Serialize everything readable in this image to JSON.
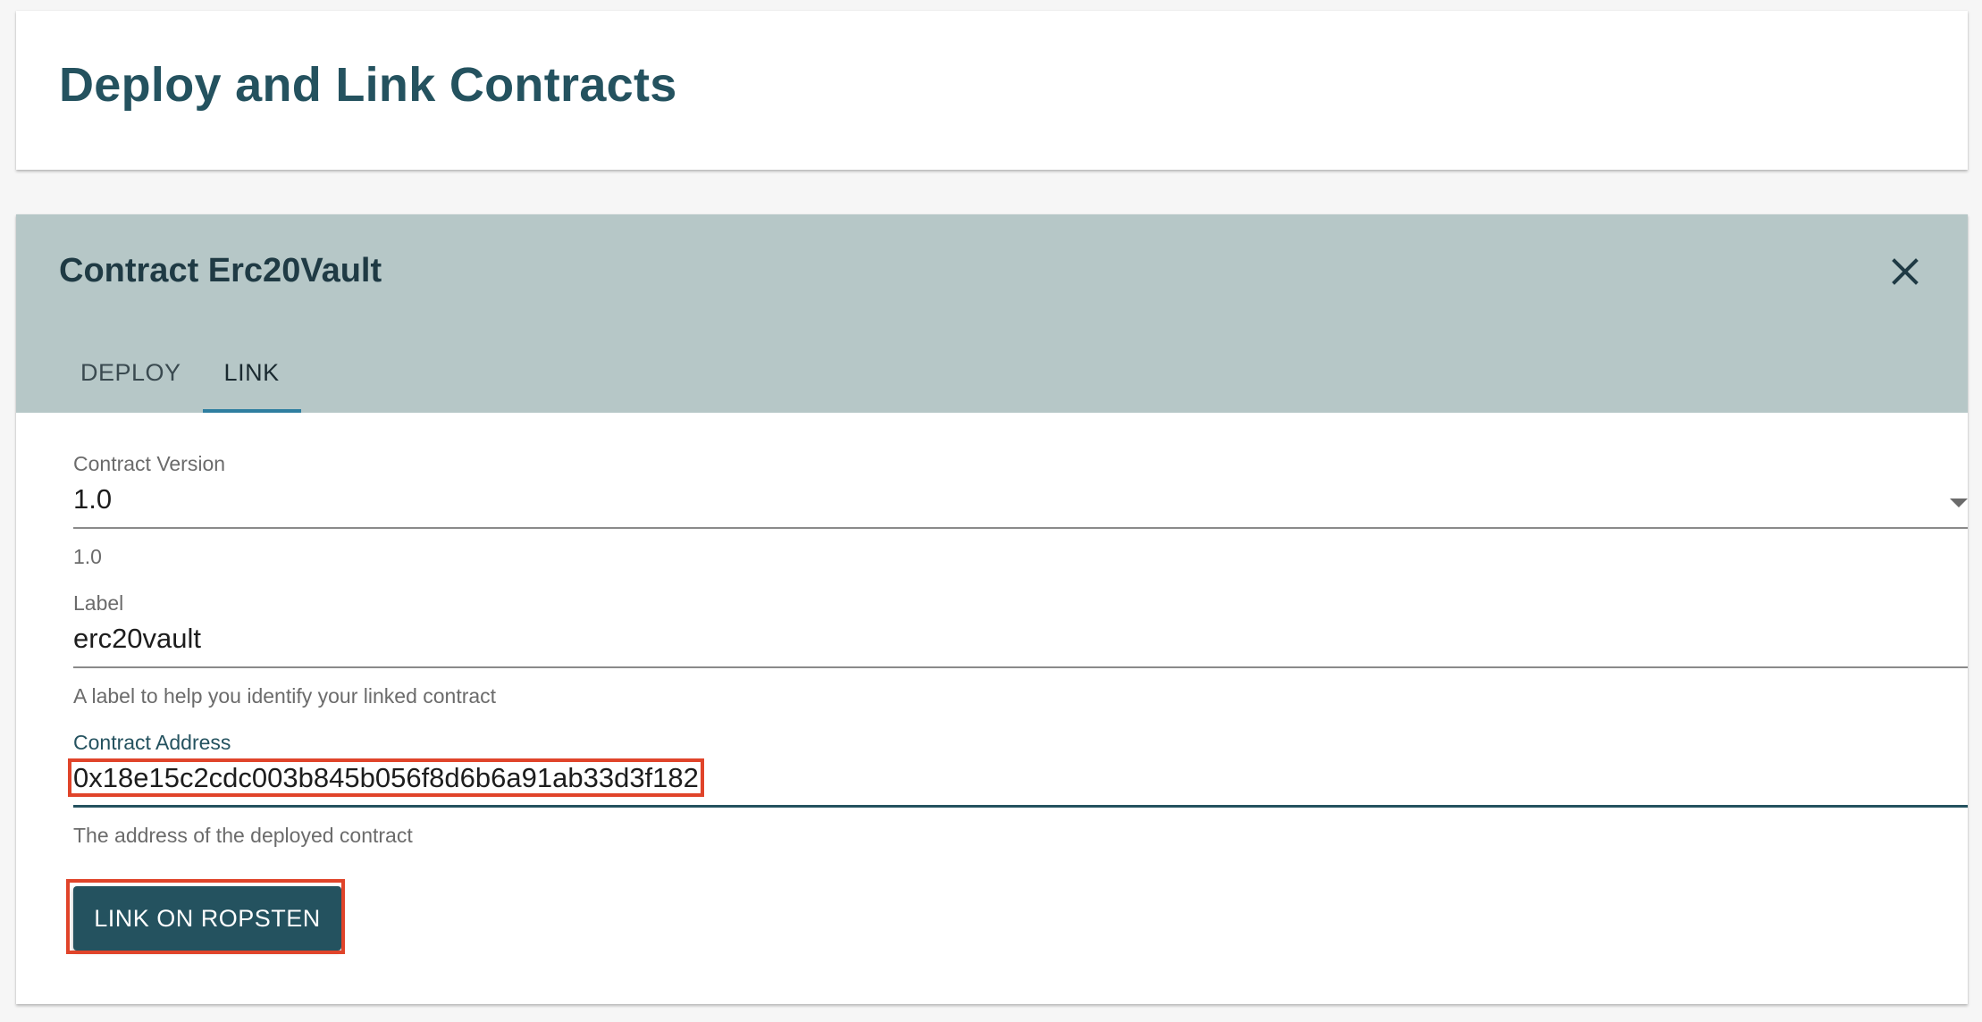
{
  "page": {
    "title": "Deploy and Link Contracts"
  },
  "panel": {
    "title": "Contract Erc20Vault",
    "close_icon": "close-icon",
    "tabs": [
      {
        "label": "DEPLOY",
        "active": false
      },
      {
        "label": "LINK",
        "active": true
      }
    ]
  },
  "form": {
    "version": {
      "label": "Contract Version",
      "value": "1.0",
      "helper": "1.0"
    },
    "label_field": {
      "label": "Label",
      "value": "erc20vault",
      "helper": "A label to help you identify your linked contract"
    },
    "address": {
      "label": "Contract Address",
      "value": "0x18e15c2cdc003b845b056f8d6b6a91ab33d3f182",
      "helper": "The address of the deployed contract"
    },
    "submit_label": "LINK ON ROPSTEN"
  },
  "colors": {
    "primary": "#24525f",
    "panel_header": "#b6c7c7",
    "tab_indicator": "#2e7ea0",
    "highlight": "#e0442a"
  }
}
